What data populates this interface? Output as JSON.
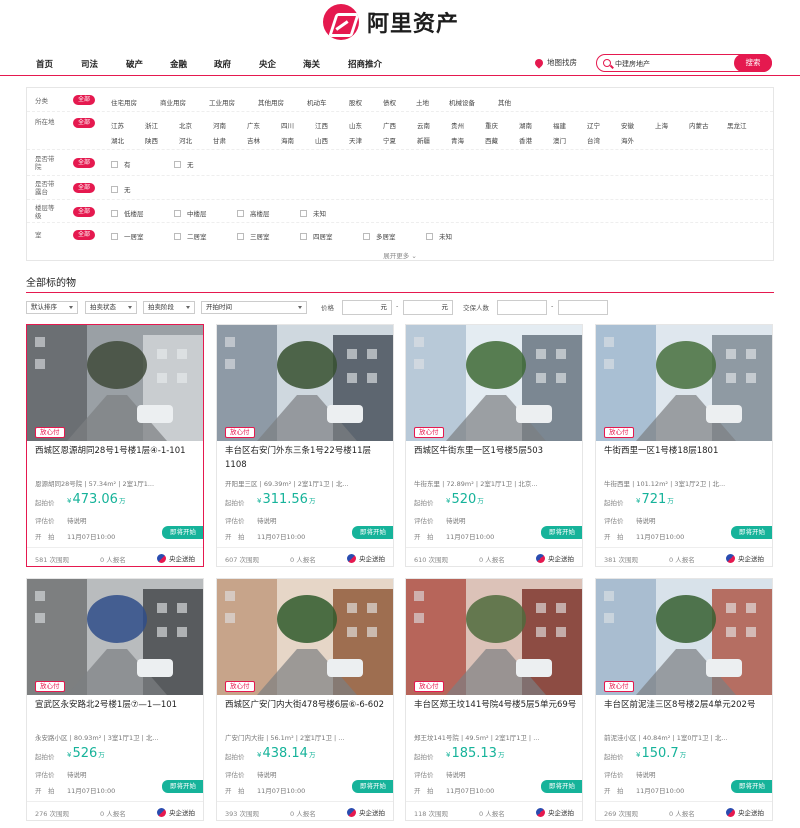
{
  "brand": {
    "name": "阿里资产",
    "color": "#e5194f",
    "logo_icon": "ali-assets-logo-icon"
  },
  "nav": {
    "items": [
      "首页",
      "司法",
      "破产",
      "金融",
      "政府",
      "央企",
      "海关",
      "招商推介"
    ],
    "map_search": "地图找房",
    "search_value": "中建房地产",
    "search_button": "搜索"
  },
  "filters": {
    "all_label": "全部",
    "rows": [
      {
        "label": "分类",
        "options": [
          "住宅用房",
          "商业用房",
          "工业用房",
          "其他用房",
          "机动车",
          "股权",
          "债权",
          "土地",
          "机械设备",
          "其他"
        ]
      },
      {
        "label": "所在地",
        "options": [
          "江苏",
          "浙江",
          "北京",
          "河南",
          "广东",
          "四川",
          "江西",
          "山东",
          "广西",
          "云南",
          "贵州",
          "重庆",
          "湖南",
          "福建",
          "辽宁",
          "安徽",
          "上海",
          "内蒙古",
          "黑龙江",
          "湖北",
          "陕西",
          "河北",
          "甘肃",
          "吉林",
          "海南",
          "山西",
          "天津",
          "宁夏",
          "新疆",
          "青海",
          "西藏",
          "香港",
          "澳门",
          "台湾",
          "海外"
        ]
      },
      {
        "label": "是否带院",
        "options": [
          "有",
          "无"
        ]
      },
      {
        "label": "是否带露台",
        "options": [
          "无"
        ]
      },
      {
        "label": "楼层等级",
        "options": [
          "低楼层",
          "中楼层",
          "高楼层",
          "未知"
        ]
      },
      {
        "label": "室",
        "options": [
          "一居室",
          "二居室",
          "三居室",
          "四居室",
          "多居室",
          "未知"
        ]
      }
    ],
    "show_more": "展开更多"
  },
  "section": {
    "title": "全部标的物",
    "sort": [
      "默认排序",
      "拍卖状态",
      "拍卖阶段",
      "开拍时间"
    ],
    "price_label": "价格",
    "price_unit": "元",
    "range_sep": "-",
    "bidders_label": "交保人数"
  },
  "labels": {
    "start_price": "起拍价",
    "eval_price": "评估价",
    "start_time": "开　拍",
    "tag": "放心付",
    "status": "即将开始",
    "views_suffix": "次围观",
    "signed": "0 人报名",
    "currency": "¥",
    "unit": "万",
    "pending": "待说明",
    "time": "11月07日10:00"
  },
  "cards": [
    {
      "title": "西城区恩源胡同28号1号楼1层④-1-101",
      "info": "恩源胡同28号院 | 57.34m² | 2室1厅1...",
      "price": "473.06",
      "views": "581",
      "seller": "央企送拍"
    },
    {
      "title": "丰台区右安门外东三条1号22号楼11层1108",
      "info": "开阳里三区 | 69.39m² | 2室1厅1卫 | 北...",
      "price": "311.56",
      "views": "607",
      "seller": "央企送拍"
    },
    {
      "title": "西城区牛街东里一区1号楼5层503",
      "info": "牛街东里 | 72.89m² | 2室1厅1卫 | 北京...",
      "price": "520",
      "views": "610",
      "seller": "央企送拍"
    },
    {
      "title": "牛街西里一区1号楼18层1801",
      "info": "牛街西里 | 101.12m² | 3室1厅2卫 | 北...",
      "price": "721",
      "views": "381",
      "seller": "央企送拍"
    },
    {
      "title": "宣武区永安路北2号楼1层⑦—1—101",
      "info": "永安路小区 | 80.93m² | 3室1厅1卫 | 北...",
      "price": "526",
      "views": "276",
      "seller": "央企送拍"
    },
    {
      "title": "西城区广安门内大街478号楼6层⑥-6-602",
      "info": "广安门内大街 | 56.1m² | 2室1厅1卫 | ...",
      "price": "438.14",
      "views": "393",
      "seller": "央企送拍"
    },
    {
      "title": "丰台区郑王坟141号院4号楼5层5单元69号",
      "info": "郑王坟141号院 | 49.5m² | 2室1厅1卫 | ...",
      "price": "185.13",
      "views": "118",
      "seller": "央企送拍"
    },
    {
      "title": "丰台区前泥洼三区8号楼2层4单元202号",
      "info": "前泥洼小区 | 40.84m² | 1室0厅1卫 | 北...",
      "price": "150.7",
      "views": "269",
      "seller": "央企送拍"
    }
  ]
}
